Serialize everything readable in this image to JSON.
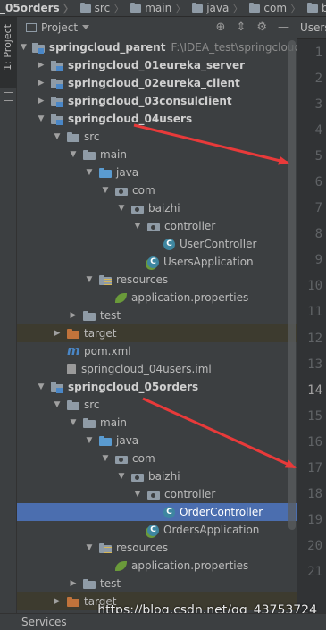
{
  "breadcrumb": [
    "_05orders",
    "src",
    "main",
    "java",
    "com",
    "baizhi"
  ],
  "tool_stripe": {
    "project_label": "1: Project"
  },
  "panel": {
    "title": "Project"
  },
  "editor": {
    "tab_label": "Users",
    "line_numbers": [
      "1",
      "2",
      "3",
      "4",
      "5",
      "6",
      "7",
      "8",
      "9",
      "10",
      "11",
      "12",
      "13",
      "14",
      "15",
      "16",
      "17",
      "18",
      "19",
      "20",
      "21"
    ],
    "current_line": "14"
  },
  "tree": [
    {
      "label": "springcloud_parent",
      "path": "F:\\IDEA_test\\springcloud_parent",
      "icon": "module-folder",
      "bold": true,
      "indent": 0,
      "arrow": "down"
    },
    {
      "label": "springcloud_01eureka_server",
      "icon": "module-folder",
      "bold": true,
      "indent": 1,
      "arrow": "right"
    },
    {
      "label": "springcloud_02eureka_client",
      "icon": "module-folder",
      "bold": true,
      "indent": 1,
      "arrow": "right"
    },
    {
      "label": "springcloud_03consulclient",
      "icon": "module-folder",
      "bold": true,
      "indent": 1,
      "arrow": "right"
    },
    {
      "label": "springcloud_04users",
      "icon": "module-folder",
      "bold": true,
      "indent": 1,
      "arrow": "down"
    },
    {
      "label": "src",
      "icon": "folder",
      "indent": 2,
      "arrow": "down"
    },
    {
      "label": "main",
      "icon": "folder",
      "indent": 3,
      "arrow": "down"
    },
    {
      "label": "java",
      "icon": "source-folder",
      "indent": 4,
      "arrow": "down"
    },
    {
      "label": "com",
      "icon": "package",
      "indent": 5,
      "arrow": "down"
    },
    {
      "label": "baizhi",
      "icon": "package",
      "indent": 6,
      "arrow": "down"
    },
    {
      "label": "controller",
      "icon": "package",
      "indent": 7,
      "arrow": "down"
    },
    {
      "label": "UserController",
      "icon": "class",
      "indent": 8,
      "arrow": "none"
    },
    {
      "label": "UsersApplication",
      "icon": "spring-class",
      "indent": 7,
      "arrow": "none"
    },
    {
      "label": "resources",
      "icon": "resources-folder",
      "indent": 4,
      "arrow": "down"
    },
    {
      "label": "application.properties",
      "icon": "spring-leaf",
      "indent": 5,
      "arrow": "none"
    },
    {
      "label": "test",
      "icon": "folder",
      "indent": 3,
      "arrow": "right"
    },
    {
      "label": "target",
      "icon": "excluded-folder",
      "indent": 2,
      "arrow": "right",
      "excluded": true
    },
    {
      "label": "pom.xml",
      "icon": "maven",
      "indent": 2,
      "arrow": "none"
    },
    {
      "label": "springcloud_04users.iml",
      "icon": "iml-file",
      "indent": 2,
      "arrow": "none"
    },
    {
      "label": "springcloud_05orders",
      "icon": "module-folder",
      "bold": true,
      "indent": 1,
      "arrow": "down"
    },
    {
      "label": "src",
      "icon": "folder",
      "indent": 2,
      "arrow": "down"
    },
    {
      "label": "main",
      "icon": "folder",
      "indent": 3,
      "arrow": "down"
    },
    {
      "label": "java",
      "icon": "source-folder",
      "indent": 4,
      "arrow": "down"
    },
    {
      "label": "com",
      "icon": "package",
      "indent": 5,
      "arrow": "down"
    },
    {
      "label": "baizhi",
      "icon": "package",
      "indent": 6,
      "arrow": "down"
    },
    {
      "label": "controller",
      "icon": "package",
      "indent": 7,
      "arrow": "down"
    },
    {
      "label": "OrderController",
      "icon": "class",
      "indent": 8,
      "arrow": "none",
      "selected": true
    },
    {
      "label": "OrdersApplication",
      "icon": "spring-class",
      "indent": 7,
      "arrow": "none"
    },
    {
      "label": "resources",
      "icon": "resources-folder",
      "indent": 4,
      "arrow": "down"
    },
    {
      "label": "application.properties",
      "icon": "spring-leaf",
      "indent": 5,
      "arrow": "none"
    },
    {
      "label": "test",
      "icon": "folder",
      "indent": 3,
      "arrow": "right"
    },
    {
      "label": "target",
      "icon": "excluded-folder",
      "indent": 2,
      "arrow": "right",
      "excluded": true
    }
  ],
  "statusbar": {
    "services_label": "Services"
  },
  "watermark": "https://blog.csdn.net/qq_43753724",
  "colors": {
    "selection": "#4b6eaf",
    "annotation_arrow": "#e83a3a",
    "panel_bg": "#3c3f41",
    "editor_bg": "#2b2b2b"
  }
}
